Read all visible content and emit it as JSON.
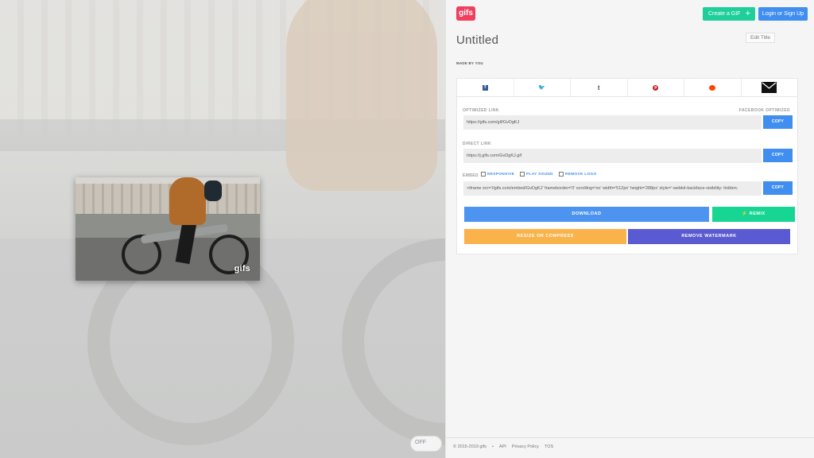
{
  "header": {
    "logo_text": "gifs",
    "create_label": "Create a GIF",
    "create_icon": "+",
    "login_label": "Login or Sign Up"
  },
  "gif": {
    "title": "Untitled",
    "edit_title_label": "Edit Title",
    "made_by": "MADE BY YOU",
    "watermark": "gifs"
  },
  "share": {
    "icons": [
      "facebook-icon",
      "twitter-icon",
      "tumblr-icon",
      "pinterest-icon",
      "reddit-icon",
      "email-icon"
    ]
  },
  "links": {
    "optimized_label": "OPTIMIZED LINK",
    "facebook_optimized_label": "FACEBOOK OPTIMIZED",
    "optimized_value": "https://gifs.com/gif/GvDgKJ",
    "direct_label": "DIRECT LINK",
    "direct_value": "https://j.gifs.com/GvDgKJ.gif",
    "embed_label": "EMBED",
    "embed_responsive": "RESPONSIVE",
    "embed_play_sound": "PLAY SOUND",
    "embed_remove_logo": "REMOVE LOGO",
    "embed_value": "<iframe src='//gifs.com/embed/GvDgKJ' frameborder='0' scrolling='no' width='512px' height='288px' style='-webkit-backface-visibility: hidden;",
    "copy_label": "COPY"
  },
  "actions": {
    "download": "DOWNLOAD",
    "remix": "⚡ REMIX",
    "resize": "RESIZE OR COMPRESS",
    "remove_watermark": "REMOVE WATERMARK"
  },
  "footer": {
    "copyright": "© 2015-2019 gifs",
    "bullet": "•",
    "api": "API",
    "privacy": "Privacy Policy",
    "tos": "TOS"
  },
  "toggle": {
    "label": "OFF"
  },
  "colors": {
    "brand": "#f0405e",
    "primary": "#3f8ef0",
    "green": "#1fcf9b",
    "orange": "#fab24a",
    "purple": "#5a5ad2"
  }
}
